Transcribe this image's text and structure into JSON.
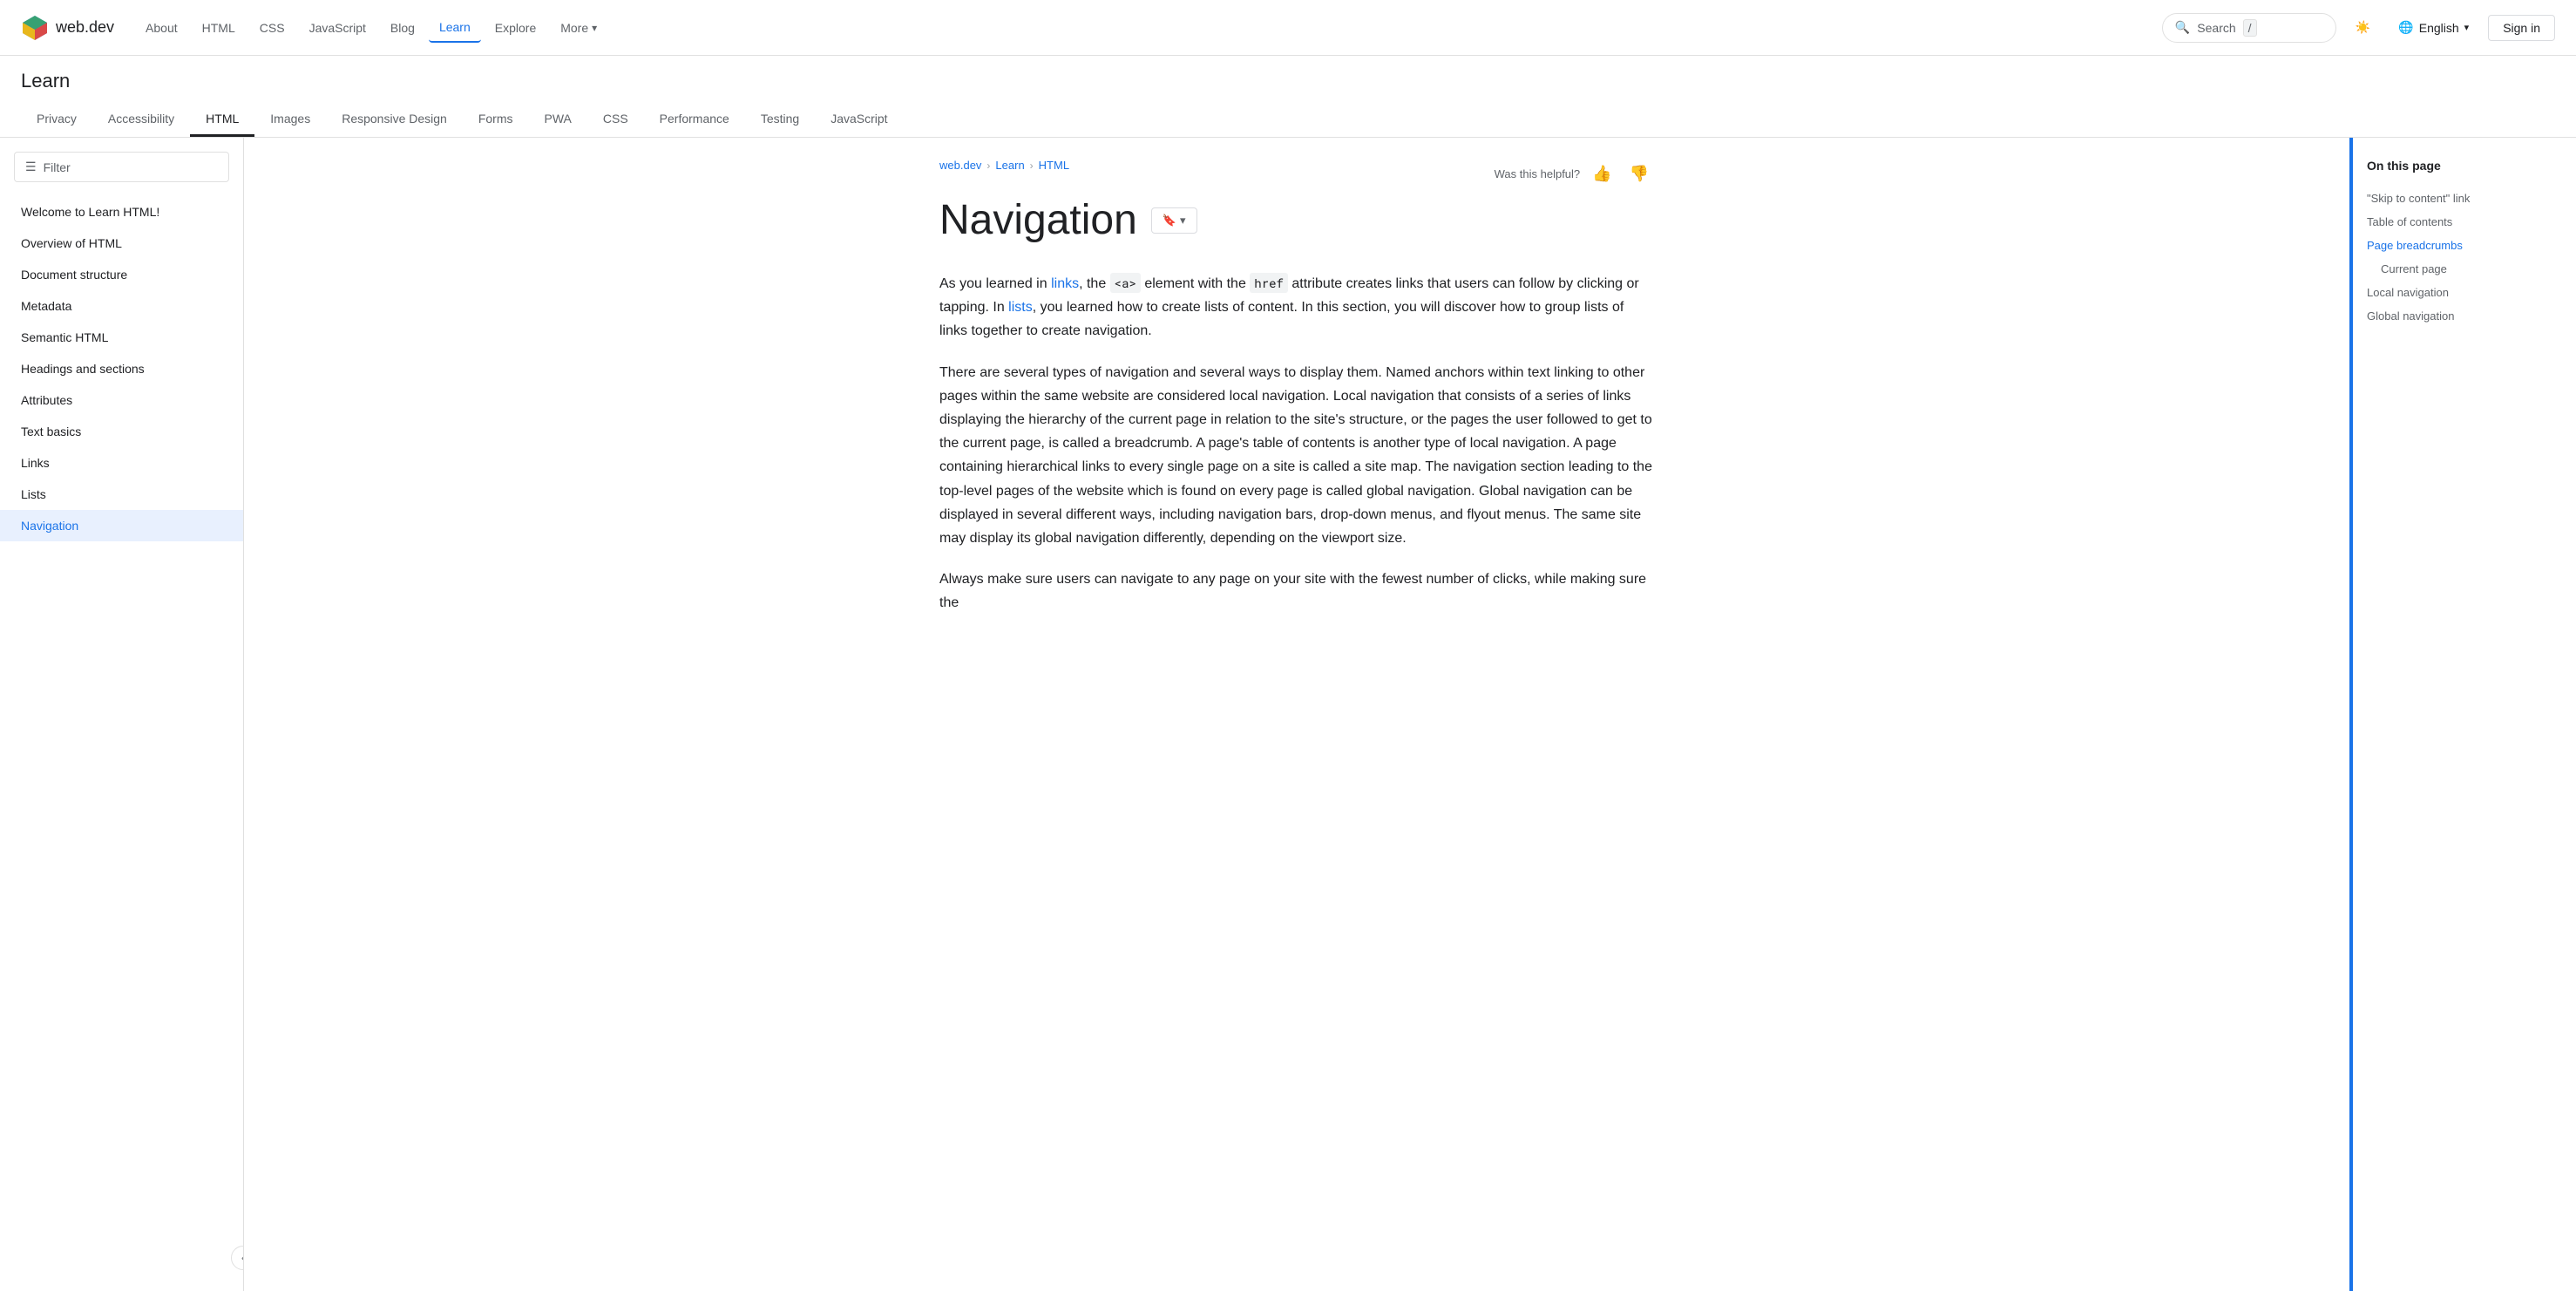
{
  "logo": {
    "text": "web.dev"
  },
  "topnav": {
    "links": [
      {
        "id": "about",
        "label": "About",
        "active": false
      },
      {
        "id": "html",
        "label": "HTML",
        "active": false
      },
      {
        "id": "css",
        "label": "CSS",
        "active": false
      },
      {
        "id": "javascript",
        "label": "JavaScript",
        "active": false
      },
      {
        "id": "blog",
        "label": "Blog",
        "active": false
      },
      {
        "id": "learn",
        "label": "Learn",
        "active": true
      },
      {
        "id": "explore",
        "label": "Explore",
        "active": false
      },
      {
        "id": "more",
        "label": "More",
        "active": false,
        "hasDropdown": true
      }
    ],
    "search_placeholder": "Search",
    "search_shortcut": "/",
    "language_label": "English",
    "signin_label": "Sign in"
  },
  "learn_section": {
    "title": "Learn",
    "tabs": [
      {
        "id": "privacy",
        "label": "Privacy",
        "active": false
      },
      {
        "id": "accessibility",
        "label": "Accessibility",
        "active": false
      },
      {
        "id": "html",
        "label": "HTML",
        "active": true
      },
      {
        "id": "images",
        "label": "Images",
        "active": false
      },
      {
        "id": "responsive-design",
        "label": "Responsive Design",
        "active": false
      },
      {
        "id": "forms",
        "label": "Forms",
        "active": false
      },
      {
        "id": "pwa",
        "label": "PWA",
        "active": false
      },
      {
        "id": "css",
        "label": "CSS",
        "active": false
      },
      {
        "id": "performance",
        "label": "Performance",
        "active": false
      },
      {
        "id": "testing",
        "label": "Testing",
        "active": false
      },
      {
        "id": "javascript",
        "label": "JavaScript",
        "active": false
      }
    ]
  },
  "sidebar": {
    "filter_label": "Filter",
    "items": [
      {
        "id": "welcome",
        "label": "Welcome to Learn HTML!",
        "active": false
      },
      {
        "id": "overview",
        "label": "Overview of HTML",
        "active": false
      },
      {
        "id": "document-structure",
        "label": "Document structure",
        "active": false
      },
      {
        "id": "metadata",
        "label": "Metadata",
        "active": false
      },
      {
        "id": "semantic-html",
        "label": "Semantic HTML",
        "active": false
      },
      {
        "id": "headings-sections",
        "label": "Headings and sections",
        "active": false
      },
      {
        "id": "attributes",
        "label": "Attributes",
        "active": false
      },
      {
        "id": "text-basics",
        "label": "Text basics",
        "active": false
      },
      {
        "id": "links",
        "label": "Links",
        "active": false
      },
      {
        "id": "lists",
        "label": "Lists",
        "active": false
      },
      {
        "id": "navigation",
        "label": "Navigation",
        "active": true
      }
    ],
    "collapse_icon": "‹"
  },
  "content": {
    "breadcrumb": [
      {
        "label": "web.dev",
        "href": "#"
      },
      {
        "label": "Learn",
        "href": "#"
      },
      {
        "label": "HTML",
        "href": "#"
      }
    ],
    "helpful_label": "Was this helpful?",
    "title": "Navigation",
    "bookmark_label": "▾",
    "body_paragraphs": [
      "As you learned in {links}, the {a_tag} element with the {href_attr} attribute creates links that users can follow by clicking or tapping. In {lists}, you learned how to create lists of content. In this section, you will discover how to group lists of links together to create navigation.",
      "There are several types of navigation and several ways to display them. Named anchors within text linking to other pages within the same website are considered local navigation. Local navigation that consists of a series of links displaying the hierarchy of the current page in relation to the site's structure, or the pages the user followed to get to the current page, is called a breadcrumb. A page's table of contents is another type of local navigation. A page containing hierarchical links to every single page on a site is called a site map. The navigation section leading to the top-level pages of the website which is found on every page is called global navigation. Global navigation can be displayed in several different ways, including navigation bars, drop-down menus, and flyout menus. The same site may display its global navigation differently, depending on the viewport size.",
      "Always make sure users can navigate to any page on your site with the fewest number of clicks, while making sure the"
    ]
  },
  "toc": {
    "title": "On this page",
    "items": [
      {
        "id": "skip-to-content",
        "label": "\"Skip to content\" link",
        "active": false,
        "sub": false
      },
      {
        "id": "table-of-contents",
        "label": "Table of contents",
        "active": false,
        "sub": false
      },
      {
        "id": "page-breadcrumbs",
        "label": "Page breadcrumbs",
        "active": true,
        "sub": false
      },
      {
        "id": "current-page",
        "label": "Current page",
        "active": false,
        "sub": true
      },
      {
        "id": "local-navigation",
        "label": "Local navigation",
        "active": false,
        "sub": false
      },
      {
        "id": "global-navigation",
        "label": "Global navigation",
        "active": false,
        "sub": false
      }
    ]
  }
}
